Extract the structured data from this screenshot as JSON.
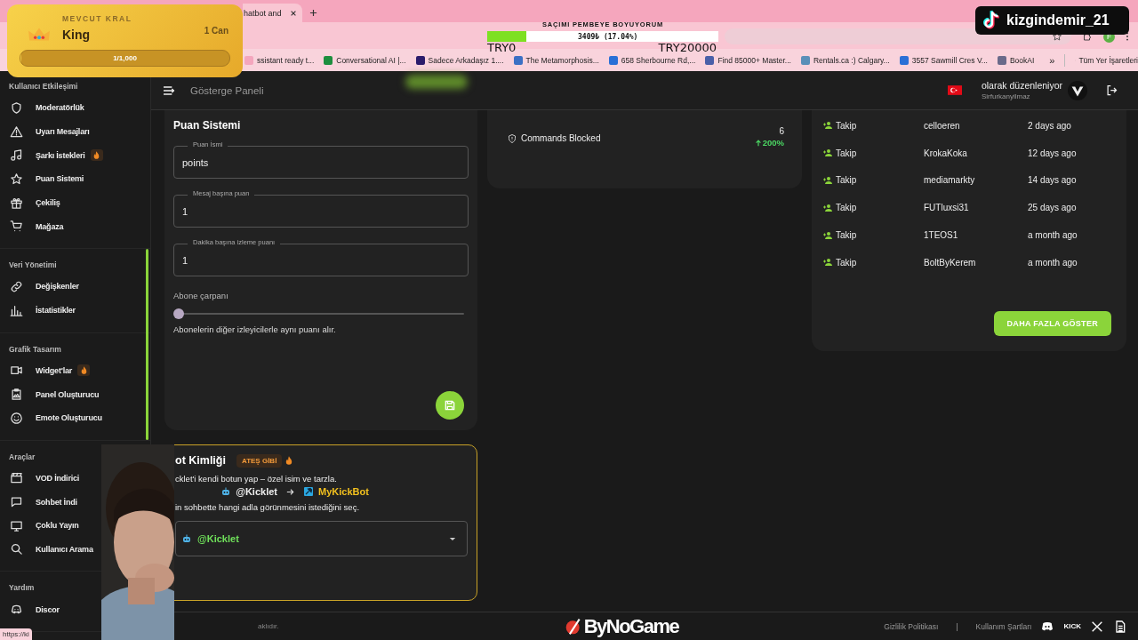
{
  "browser": {
    "tab": {
      "title": "hatbot and"
    },
    "bookmarks": [
      {
        "label": "ssistant ready t...",
        "color": "#f4a6bd"
      },
      {
        "label": "Conversational AI |...",
        "color": "#1e8e3e"
      },
      {
        "label": "Sadece Arkadaşız 1....",
        "color": "#2b1b6b"
      },
      {
        "label": "The Metamorphosis...",
        "color": "#3b6fc4"
      },
      {
        "label": "658 Sherbourne Rd,...",
        "color": "#2a6fd6"
      },
      {
        "label": "Find 85000+ Master...",
        "color": "#4a5fa8"
      },
      {
        "label": "Rentals.ca :) Calgary...",
        "color": "#5a8fb8"
      },
      {
        "label": "3557 Sawmill Cres V...",
        "color": "#2a6fd6"
      },
      {
        "label": "BookAI",
        "color": "#6a6a8a"
      }
    ],
    "more": "»",
    "all_bookmarks": "Tüm Yer İşaretleri",
    "profile": "F"
  },
  "overlays": {
    "king": {
      "heading": "MEVCUT KRAL",
      "name": "King",
      "lives": "1 Can",
      "progress": "1/1,000",
      "level": 0.001
    },
    "donation": {
      "title": "SAÇIMI PEMBEYE BOYUYORUM",
      "amount": "3409₺ (17.04%)",
      "level": 0.1704,
      "min": "TRY0",
      "max": "TRY20000"
    },
    "tiktok": {
      "handle": "kizgindemir_21"
    },
    "status_link": "https://ki"
  },
  "header": {
    "title": "Gösterge Paneli",
    "editing_as": "olarak düzenleniyor",
    "username": "Sirfurkanyilmaz"
  },
  "sidebar": {
    "sections": [
      {
        "title": "Kullanıcı Etkileşimi",
        "items": [
          {
            "label": "Moderatörlük",
            "hot": false
          },
          {
            "label": "Uyarı Mesajları",
            "hot": false
          },
          {
            "label": "Şarkı İstekleri",
            "hot": true
          },
          {
            "label": "Puan Sistemi",
            "hot": false
          },
          {
            "label": "Çekiliş",
            "hot": false
          },
          {
            "label": "Mağaza",
            "hot": false
          }
        ]
      },
      {
        "title": "Veri Yönetimi",
        "items": [
          {
            "label": "Değişkenler",
            "hot": false
          },
          {
            "label": "İstatistikler",
            "hot": false
          }
        ]
      },
      {
        "title": "Grafik Tasarım",
        "items": [
          {
            "label": "Widget'lar",
            "hot": true
          },
          {
            "label": "Panel Oluşturucu",
            "hot": false
          },
          {
            "label": "Emote Oluşturucu",
            "hot": false
          }
        ]
      },
      {
        "title": "Araçlar",
        "items": [
          {
            "label": "VOD İndirici",
            "hot": false
          },
          {
            "label": "Sohbet İndi",
            "hot": false
          },
          {
            "label": "Çoklu Yayın",
            "hot": false
          },
          {
            "label": "Kullanıcı Arama",
            "hot": false
          }
        ]
      },
      {
        "title": "Yardım",
        "items": [
          {
            "label": "Discor",
            "hot": false
          }
        ]
      }
    ]
  },
  "points_card": {
    "title": "Puan Sistemi",
    "fields": [
      {
        "label": "Puan İsmi",
        "value": "points"
      },
      {
        "label": "Mesaj başına puan",
        "value": "1"
      },
      {
        "label": "Dakika başına izleme puanı",
        "value": "1"
      }
    ],
    "multiplier": {
      "label": "Abone çarpanı",
      "level": 0,
      "description": "Abonelerin diğer izleyicilerle aynı puanı alır."
    }
  },
  "stat_card": {
    "label": "Commands Blocked",
    "value": "6",
    "change": "200%"
  },
  "activity": {
    "rows": [
      {
        "type": "Takip",
        "user": "celloeren",
        "time": "2 days ago"
      },
      {
        "type": "Takip",
        "user": "KrokaKoka",
        "time": "12 days ago"
      },
      {
        "type": "Takip",
        "user": "mediamarkty",
        "time": "14 days ago"
      },
      {
        "type": "Takip",
        "user": "FUTluxsi31",
        "time": "25 days ago"
      },
      {
        "type": "Takip",
        "user": "1TEOS1",
        "time": "a month ago"
      },
      {
        "type": "Takip",
        "user": "BoltByKerem",
        "time": "a month ago"
      }
    ],
    "more_button": "DAHA FAZLA GÖSTER"
  },
  "bot_identity": {
    "title": "ot Kimliği",
    "badge": "ATEŞ GİBİ",
    "intro": "cklet'i kendi botun yap – özel isim ve tarzla.",
    "from": "@Kicklet",
    "to": "MyKickBot",
    "prompt": "in sohbette hangi adla görünmesini istediğini seç.",
    "selected_name": "@Kicklet"
  },
  "footer": {
    "copyright": "aklıdır.",
    "brand": "ByNoGame",
    "links": [
      "Gizlilik Politikası",
      "Kullanım Şartları"
    ],
    "separator": "|",
    "kick": "KICK"
  }
}
